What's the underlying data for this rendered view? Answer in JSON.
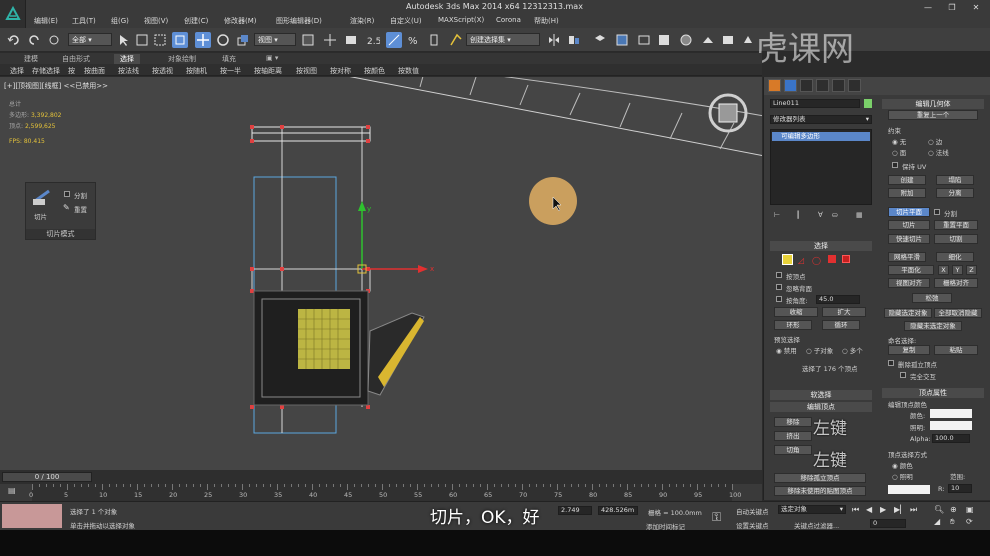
{
  "window": {
    "title": "Autodesk 3ds Max  2014 x64     12312313.max"
  },
  "menu": [
    "编辑(E)",
    "工具(T)",
    "组(G)",
    "视图(V)",
    "创建(C)",
    "修改器(M)",
    "图形编辑器(D)",
    "渲染(R)",
    "自定义(U)",
    "MAXScript(X)",
    "Corona",
    "帮助(H)"
  ],
  "toolbar": {
    "filter": "全部",
    "ref_coord": "视图",
    "selection_set": "创建选择集"
  },
  "ribbon": {
    "tabs": [
      "建模",
      "自由形式",
      "选择",
      "对象绘制",
      "填充"
    ]
  },
  "subbar": [
    "选择",
    "存储选择",
    "按",
    "按曲面",
    "按法线",
    "按透视",
    "按随机",
    "按一半",
    "按轴距离",
    "按视图",
    "按对称",
    "按颜色",
    "按数值"
  ],
  "viewport": {
    "label": "[+][顶视图][线框] <<已禁用>>",
    "stats_total": "总计",
    "polys_label": "多边形:",
    "polys_value": "3,392,802",
    "verts_label": "顶点:",
    "verts_value": "2,599,625",
    "fps_label": "FPS:",
    "fps_value": "80.415",
    "slice_label": "切片",
    "split_label": "分割",
    "reset_label": "重置",
    "slice_mode_label": "切片模式"
  },
  "cmdpanel": {
    "object_name": "Line011",
    "modifier_list": "修改器列表",
    "stack_item": "可编辑多边形",
    "select_header": "选择",
    "by_vertex": "按顶点",
    "ignore_back": "忽略背面",
    "by_angle": "按角度:",
    "angle_value": "45.0",
    "shrink": "收缩",
    "grow": "扩大",
    "ring": "环形",
    "loop": "循环",
    "preview_sel": "预览选择",
    "disable": "禁用",
    "subobj": "子对象",
    "multi": "多个",
    "sel_status": "选择了 176 个顶点",
    "soft_sel": "软选择",
    "edit_vertex": "编辑顶点",
    "remove": "移除",
    "extrude": "挤出",
    "chamfer": "切角",
    "remove_iso": "移除孤立顶点",
    "remove_unused": "移除未使用的贴图顶点",
    "edit_geom": "编辑几何体",
    "repeat_last": "重复上一个",
    "constraint": "约束",
    "none": "无",
    "edge": "边",
    "face": "面",
    "normal": "法线",
    "keep_uv": "保持 UV",
    "create": "创建",
    "collapse": "塌陷",
    "attach": "附加",
    "detach": "分离",
    "slice_plane": "切片平面",
    "split": "分割",
    "slice": "切片",
    "reset_plane": "重置平面",
    "quick_slice": "快速切片",
    "cut": "切割",
    "meshsmooth": "网格平滑",
    "tessellate": "细化",
    "planarize": "平面化",
    "x": "X",
    "y": "Y",
    "z": "Z",
    "view_align": "视图对齐",
    "grid_align": "栅格对齐",
    "relax": "松弛",
    "hide_sel": "隐藏选定对象",
    "unhide_all": "全部取消隐藏",
    "hide_unsel": "隐藏未选定对象",
    "named_sel": "命名选择:",
    "copy": "复制",
    "paste": "粘贴",
    "delete_iso": "删除孤立顶点",
    "full_interact": "完全交互",
    "vertex_props": "顶点属性",
    "edit_vertex_color": "编辑顶点颜色",
    "color": "颜色:",
    "illum": "照明:",
    "alpha": "Alpha:",
    "alpha_value": "100.0",
    "sel_by_vertex": "顶点选择方式",
    "color_opt": "颜色",
    "illum_opt": "照明",
    "range": "范围:",
    "r": "R:",
    "r_value": "10"
  },
  "timeline": {
    "frame": "0 / 100",
    "ticks": [
      "0",
      "5",
      "10",
      "15",
      "20",
      "25",
      "30",
      "35",
      "40",
      "45",
      "50",
      "55",
      "60",
      "65",
      "70",
      "75",
      "80",
      "85",
      "90",
      "95",
      "100"
    ]
  },
  "status": {
    "selected": "选择了 1 个对象",
    "hint": "单击并拖动以选择对象",
    "x_value": "2.749",
    "y_value": "428.526m",
    "grid": "栅格 = 100.0mm",
    "autokey": "自动关键点",
    "setkey": "设置关键点",
    "keyfilter": "关键点过滤器...",
    "sel_obj": "选定对象",
    "add_time_tag": "添加时间标记",
    "frame_value": "0"
  },
  "overlay": {
    "subtitle": "切片，OK，好",
    "key1": "左键",
    "key2": "左键",
    "watermark": "虎课网"
  },
  "colors": {
    "accent": "#5b87c9",
    "stats": "#e4c23a",
    "cursor": "#d8a860"
  }
}
